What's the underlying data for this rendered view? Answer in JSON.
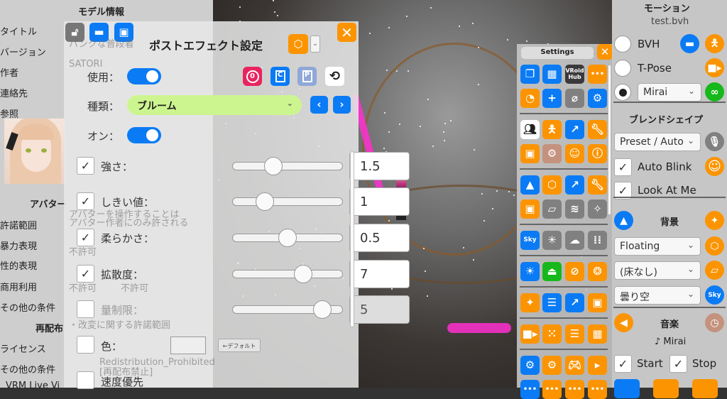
{
  "model_info": {
    "title": "モデル情報",
    "labels": [
      "タイトル",
      "バージョン",
      "作者",
      "連絡先",
      "参照"
    ],
    "avatar_section": "アバター",
    "avatar_labels": [
      "許諾範囲",
      "暴力表現",
      "性的表現",
      "商用利用",
      "その他の条件"
    ],
    "redistribution_section": "再配布",
    "redistribution_labels": [
      "ライセンス",
      "その他の条件"
    ],
    "footer": "VRM Live Vi",
    "faded_values": [
      "パンクな普段着",
      "SATORI",
      "アバターを操作することは",
      "アバター作者にのみ許される",
      "不許可",
      "不許可",
      "不許可",
      "・改変に関する許諾範囲",
      "Redistribution_Prohibited",
      "[再配布禁止]"
    ]
  },
  "post_effect": {
    "title": "ポストエフェクト設定",
    "use_label": "使用：",
    "use_on": true,
    "type_label": "種類：",
    "type_value": "ブルーム",
    "on_label": "オン：",
    "on_value": true,
    "params": [
      {
        "label": "強さ：",
        "checked": true,
        "value": "1.5",
        "level": 0.37,
        "enabled": true
      },
      {
        "label": "しきい値：",
        "checked": true,
        "value": "1",
        "level": 0.29,
        "enabled": true
      },
      {
        "label": "柔らかさ：",
        "checked": true,
        "value": "0.5",
        "level": 0.5,
        "enabled": true
      },
      {
        "label": "拡散度：",
        "checked": true,
        "value": "7",
        "level": 0.64,
        "enabled": true
      },
      {
        "label": "量制限：",
        "checked": false,
        "value": "5",
        "level": 0.82,
        "enabled": false
      }
    ],
    "color_label": "色：",
    "color_checked": false,
    "default_button": "←デフォルト",
    "speed_label": "速度優先",
    "speed_checked": false,
    "toolbar": {
      "paste_letter": "P",
      "copy_letter": "C",
      "reset_letter": "0"
    }
  },
  "settings": {
    "title": "Settings",
    "vroid_label": "VRoid Hub",
    "groups": [
      [
        [
          [
            "copy-list",
            "blue"
          ],
          [
            "grid",
            "blue"
          ],
          [
            "vroid-hub",
            "dark"
          ],
          [
            "more",
            "orange"
          ]
        ],
        [
          [
            "folder-clock",
            "orange"
          ],
          [
            "plus",
            "blue"
          ],
          [
            "mic-off",
            "gray"
          ],
          [
            "save-settings",
            "blue"
          ]
        ]
      ],
      [
        [
          [
            "users",
            "white"
          ],
          [
            "figure",
            "orange"
          ],
          [
            "axes",
            "blue"
          ],
          [
            "wrench",
            "orange"
          ]
        ],
        [
          [
            "frame",
            "orange"
          ],
          [
            "figure-gear",
            "brown"
          ],
          [
            "smile",
            "orange"
          ],
          [
            "person-info",
            "orange"
          ]
        ]
      ],
      [
        [
          [
            "mountain",
            "blue"
          ],
          [
            "cube",
            "orange"
          ],
          [
            "axes",
            "blue"
          ],
          [
            "wrench",
            "orange"
          ]
        ],
        [
          [
            "frame",
            "orange"
          ],
          [
            "floor",
            "gray"
          ],
          [
            "water",
            "gray"
          ],
          [
            "sparkle-floor",
            "gray"
          ]
        ]
      ],
      [
        [
          [
            "sky",
            "blue"
          ],
          [
            "light-point",
            "gray"
          ],
          [
            "cloud",
            "gray"
          ],
          [
            "dots",
            "gray"
          ]
        ]
      ],
      [
        [
          [
            "sun",
            "blue"
          ],
          [
            "lamp",
            "green"
          ],
          [
            "light-off",
            "orange"
          ],
          [
            "aperture",
            "orange"
          ]
        ]
      ],
      [
        [
          [
            "sparkles",
            "orange"
          ],
          [
            "sliders",
            "blue"
          ],
          [
            "axes",
            "blue"
          ],
          [
            "frame",
            "orange"
          ]
        ]
      ],
      [
        [
          [
            "camera",
            "orange"
          ],
          [
            "dot-grid",
            "orange"
          ],
          [
            "list",
            "orange"
          ],
          [
            "grid",
            "orange"
          ]
        ]
      ],
      [
        [
          [
            "gear",
            "blue"
          ],
          [
            "gear-sparkle",
            "orange"
          ],
          [
            "gamepad",
            "orange"
          ],
          [
            "camera-switch",
            "orange"
          ]
        ],
        [
          [
            "more",
            "blue"
          ],
          [
            "more",
            "orange"
          ],
          [
            "more",
            "orange"
          ],
          [
            "more",
            "orange"
          ]
        ]
      ]
    ]
  },
  "motion": {
    "title": "モーション",
    "file": "test.bvh",
    "options": [
      "BVH",
      "T-Pose"
    ],
    "selected_index": 2,
    "mirai_select": "Mirai"
  },
  "blendshape": {
    "title": "ブレンドシェイプ",
    "preset": "Preset / Auto",
    "auto_blink": "Auto Blink",
    "look_at_me": "Look At Me"
  },
  "background": {
    "title": "背景",
    "scene": "Floating",
    "floor": "(床なし)",
    "sky": "曇り空"
  },
  "music": {
    "title": "音楽",
    "track": "♪ Mirai",
    "start": "Start",
    "stop": "Stop"
  },
  "colors": {
    "blue": "#0a7bf5",
    "orange": "#fb9400",
    "gray": "#808080",
    "dark": "#3a3a3a",
    "green": "#17b81b",
    "brown": "#c4927e",
    "white": "#ffffff",
    "pink": "#e8245f",
    "type_bg": "#cdf58f"
  }
}
